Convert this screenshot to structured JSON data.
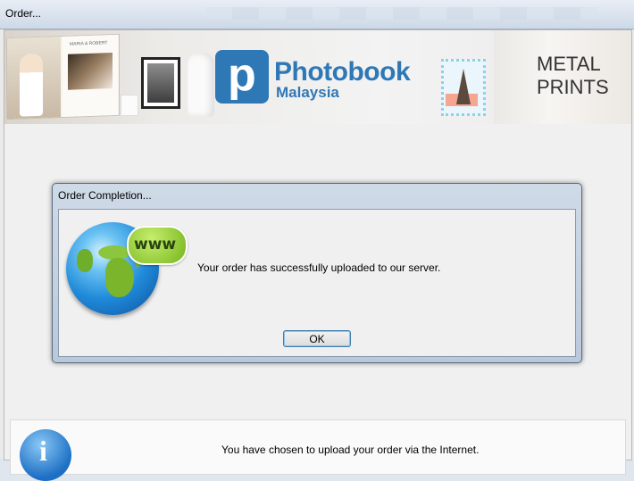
{
  "window": {
    "title": "Order..."
  },
  "banner": {
    "brand_name": "Photobook",
    "brand_sub": "Malaysia",
    "brand_letter": "p",
    "promo_line1": "METAL",
    "promo_line2": "PRINTS",
    "album_caption": "MARIA & ROBERT"
  },
  "dialog": {
    "title": "Order Completion...",
    "message": "Your order has successfully uploaded to our server.",
    "icon_label": "www",
    "ok_label": "OK"
  },
  "info": {
    "text": "You have chosen to upload your order via the Internet."
  },
  "colors": {
    "brand_blue": "#2f78b6",
    "bubble_green": "#76b51d"
  }
}
